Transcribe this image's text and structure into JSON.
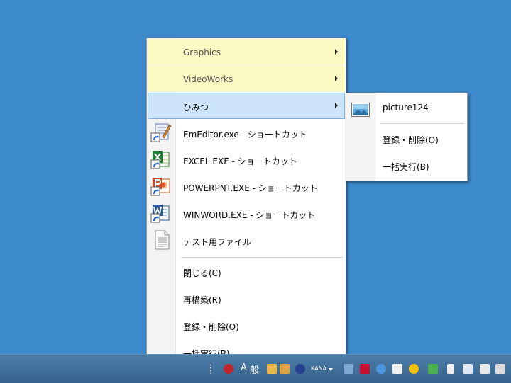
{
  "main_menu": {
    "items": [
      {
        "label": "Graphics",
        "submenu": true,
        "icon": "none"
      },
      {
        "label": "VideoWorks",
        "submenu": true,
        "icon": "none"
      },
      {
        "label": "ひみつ",
        "submenu": true,
        "icon": "none"
      },
      {
        "label": "EmEditor.exe - ショートカット",
        "icon": "emeditor-shortcut-icon"
      },
      {
        "label": "EXCEL.EXE - ショートカット",
        "icon": "excel-shortcut-icon"
      },
      {
        "label": "POWERPNT.EXE - ショートカット",
        "icon": "powerpoint-shortcut-icon"
      },
      {
        "label": "WINWORD.EXE - ショートカット",
        "icon": "word-shortcut-icon"
      },
      {
        "label": "テスト用ファイル",
        "icon": "text-file-icon"
      },
      {
        "label": "閉じる(C)"
      },
      {
        "label": "再構築(R)"
      },
      {
        "label": "登録・削除(O)"
      },
      {
        "label": "一括実行(B)"
      }
    ]
  },
  "sub_menu": {
    "items": [
      {
        "label": "picture124",
        "icon": "picture-icon"
      },
      {
        "label": "登録・削除(O)"
      },
      {
        "label": "一括実行(B)"
      }
    ]
  },
  "taskbar": {
    "ime_mode": "A",
    "ime_dict": "般",
    "kana": "KANA"
  },
  "colors": {
    "desktop": "#3d8bcd",
    "folder_highlight": "#fdf9c2",
    "selected_highlight": "#cde3fa",
    "selected_border": "#7fb0e6"
  }
}
